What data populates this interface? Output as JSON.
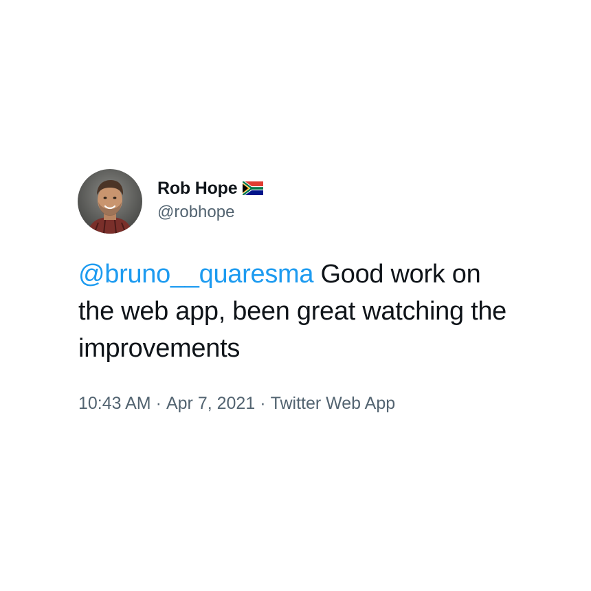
{
  "tweet": {
    "author": {
      "display_name": "Rob Hope",
      "handle": "@robhope",
      "avatar_icon": "profile-photo",
      "flag_icon": "south-africa-flag-icon"
    },
    "text": {
      "mention": "@bruno__quaresma",
      "body": " Good work on the web app, been great watching the improvements"
    },
    "meta": {
      "time": "10:43 AM",
      "separator": "·",
      "date": "Apr 7, 2021",
      "source": "Twitter Web App"
    }
  },
  "colors": {
    "text": "#0f1419",
    "secondary": "#536471",
    "link": "#1d9bf0",
    "background": "#ffffff"
  }
}
